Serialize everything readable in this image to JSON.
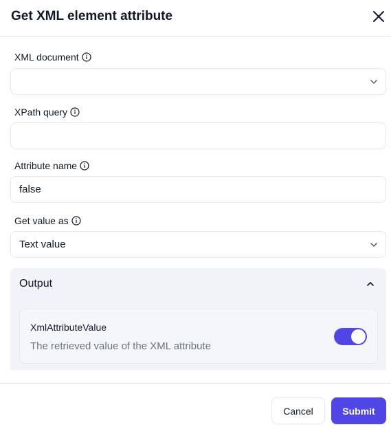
{
  "dialog": {
    "title": "Get XML element attribute",
    "close_icon": "close-icon"
  },
  "fields": {
    "xml_document": {
      "label": "XML document",
      "value": "",
      "icon": "info-icon"
    },
    "xpath_query": {
      "label": "XPath query",
      "value": "",
      "icon": "info-icon"
    },
    "attribute_name": {
      "label": "Attribute name",
      "value": "false",
      "icon": "info-icon"
    },
    "get_value_as": {
      "label": "Get value as",
      "value": "Text value",
      "icon": "info-icon"
    }
  },
  "output": {
    "title": "Output",
    "expanded": true,
    "variable": {
      "name": "XmlAttributeValue",
      "description": "The retrieved value of the XML attribute",
      "enabled": true
    }
  },
  "footer": {
    "cancel_label": "Cancel",
    "submit_label": "Submit"
  },
  "colors": {
    "accent": "#4f46e5",
    "panel_bg": "#f1f3f8",
    "border": "#e5e7eb",
    "muted_text": "#6b7280"
  }
}
